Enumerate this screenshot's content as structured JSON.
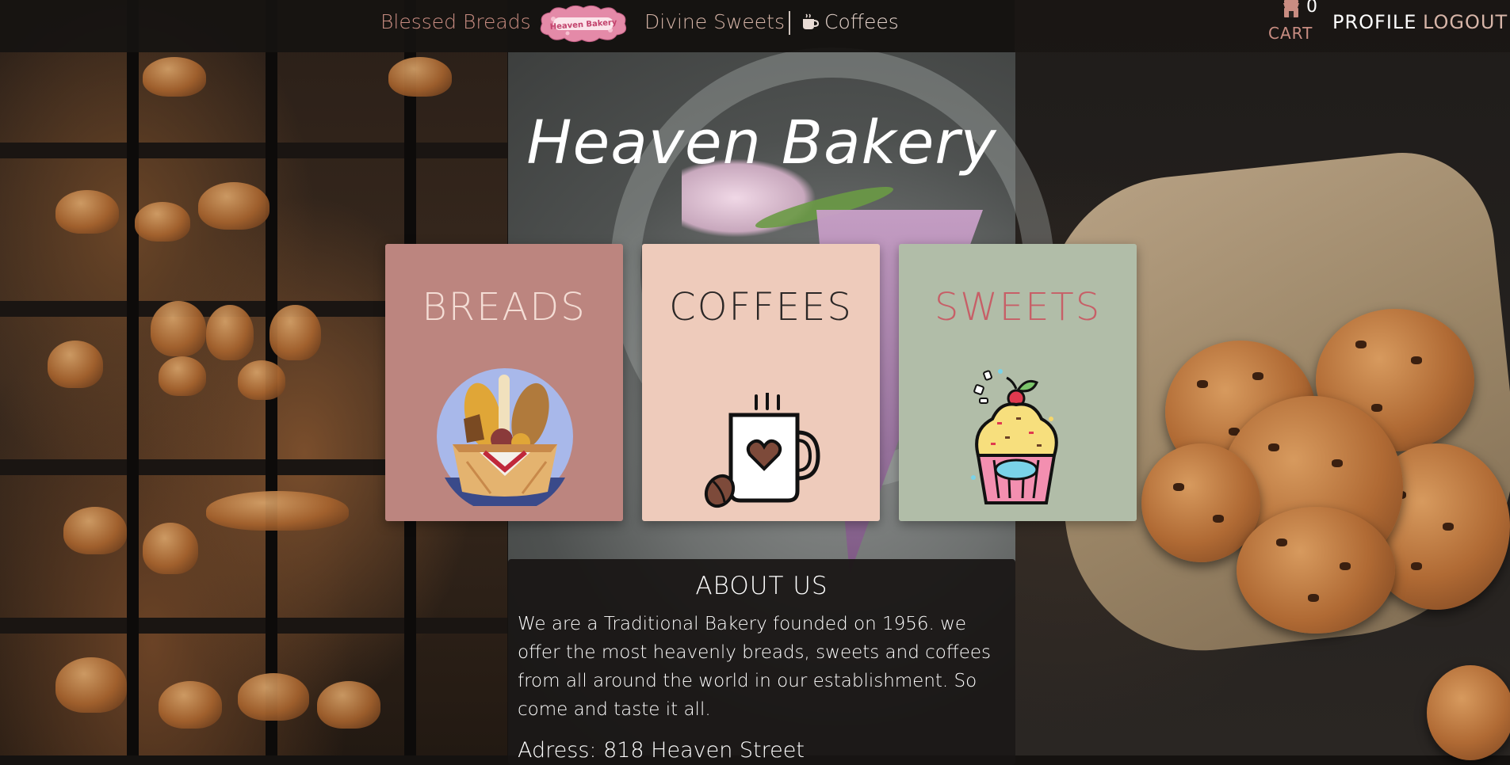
{
  "nav": {
    "blessed_breads": "Blessed Breads",
    "logo_text": "Heaven Bakery",
    "divine_sweets": "Divine Sweets",
    "coffees": "Coffees"
  },
  "account": {
    "cart_count": "0",
    "cart_label": "CART",
    "profile": "PROFILE",
    "logout": "LOGOUT"
  },
  "hero": {
    "title": "Heaven Bakery"
  },
  "categories": [
    {
      "label": "BREADS",
      "icon": "bread-basket-icon",
      "color": "#bc857f"
    },
    {
      "label": "COFFEES",
      "icon": "coffee-mug-icon",
      "color": "#eecbbb"
    },
    {
      "label": "SWEETS",
      "icon": "cupcake-icon",
      "color": "#b1bda8"
    }
  ],
  "about": {
    "title": "ABOUT US",
    "text": "We are a Traditional Bakery founded on 1956. we offer the most heavenly breads, sweets and coffees from all around the world in our establishment. So come and taste it all.",
    "address": "Adress: 818 Heaven Street"
  },
  "colors": {
    "accent_pink": "#c98d82",
    "header_bg": "#161311"
  }
}
